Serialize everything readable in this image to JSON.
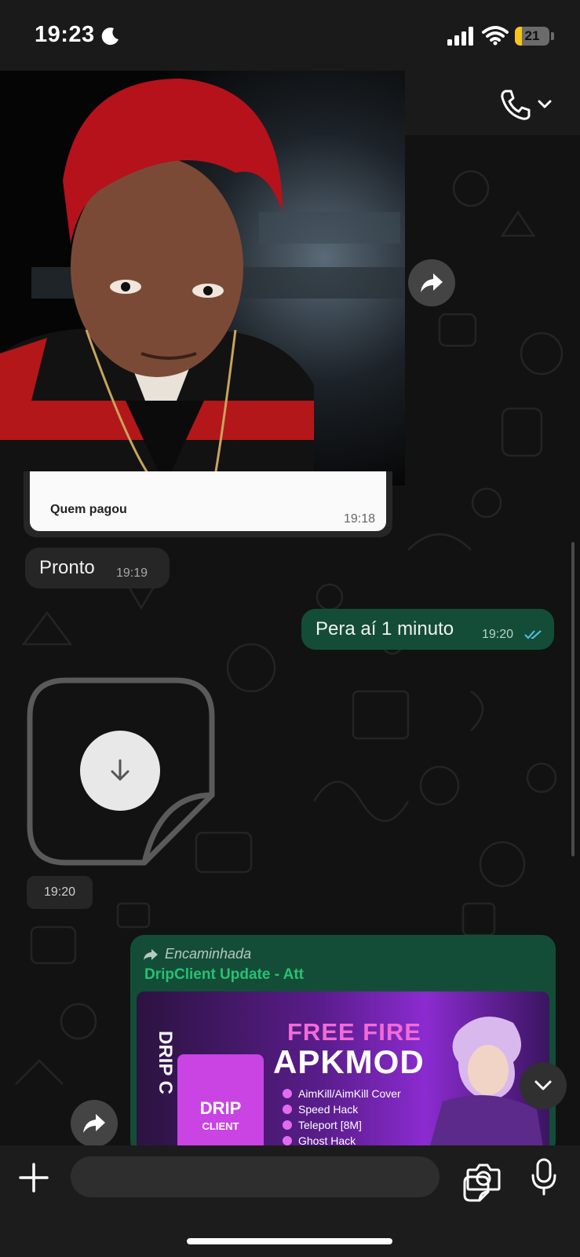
{
  "status_bar": {
    "time": "19:23",
    "battery": "21",
    "battery_level": 0.21,
    "icons": [
      "moon-icon",
      "cellular-signal-icon",
      "wifi-icon",
      "battery-icon"
    ]
  },
  "header": {
    "call_icon": "phone-icon",
    "dropdown_icon": "chevron-down-icon"
  },
  "messages": [
    {
      "type": "image_with_link_preview",
      "direction": "incoming",
      "preview_title": "Quem pagou",
      "time": "19:18"
    },
    {
      "type": "text",
      "direction": "incoming",
      "text": "Pronto",
      "time": "19:19"
    },
    {
      "type": "text",
      "direction": "outgoing",
      "text": "Pera aí 1 minuto",
      "time": "19:20",
      "status": "read"
    },
    {
      "type": "sticker_download",
      "direction": "incoming",
      "time": "19:20"
    },
    {
      "type": "forwarded_image",
      "direction": "outgoing",
      "forwarded_label": "Encaminhada",
      "title": "DripClient Update - Att",
      "image_text": {
        "headline": "FREE FIRE",
        "subheadline": "APKMOD",
        "features": [
          "AimKill/AimKill Cover",
          "Speed Hack",
          "Teleport [8M]",
          "Ghost Hack"
        ],
        "brand_vertical": "DRIP C",
        "logo_top": "DRIP",
        "logo_bottom": "CLIENT"
      }
    }
  ],
  "composer": {
    "placeholder": "",
    "icons": [
      "plus-icon",
      "sticker-icon",
      "camera-icon",
      "microphone-icon"
    ]
  },
  "colors": {
    "outgoing_bubble": "#144d37",
    "incoming_bubble": "#262626",
    "accent_green": "#28c172",
    "read_ticks": "#53bdeb"
  }
}
